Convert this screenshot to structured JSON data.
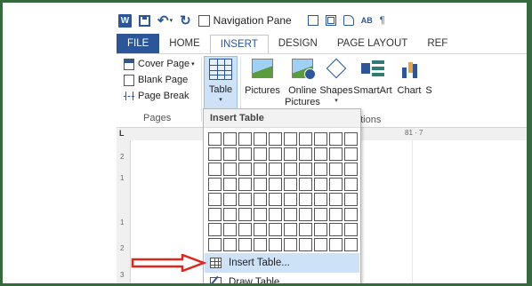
{
  "qat": {
    "word_icon": "W",
    "navigation_pane": "Navigation Pane",
    "ab_label": "AB"
  },
  "tabs": [
    {
      "label": "FILE"
    },
    {
      "label": "HOME"
    },
    {
      "label": "INSERT",
      "active": true
    },
    {
      "label": "DESIGN"
    },
    {
      "label": "PAGE LAYOUT"
    },
    {
      "label": "REF"
    }
  ],
  "pages_group": {
    "items": [
      {
        "label": "Cover Page",
        "has_dropdown": true
      },
      {
        "label": "Blank Page"
      },
      {
        "label": "Page Break"
      }
    ],
    "label": "Pages"
  },
  "ribbon": {
    "table": "Table",
    "pictures": "Pictures",
    "online_1": "Online",
    "online_2": "Pictures",
    "shapes": "Shapes",
    "smartart": "SmartArt",
    "chart": "Chart",
    "s_partial": "S",
    "illustrations_partial": "ations"
  },
  "ruler": {
    "corner": "L",
    "right_mark": "81 · 7",
    "vertical_marks": [
      "2",
      "1",
      "1",
      "2",
      "3"
    ]
  },
  "dropdown": {
    "header": "Insert Table",
    "grid": {
      "columns": 10,
      "rows": 8
    },
    "items": [
      {
        "label": "Insert Table...",
        "highlighted": true
      },
      {
        "label": "Draw Table"
      }
    ]
  },
  "colors": {
    "word_blue": "#2b579a",
    "frame_green": "#356a3c",
    "highlight": "#cde1f7",
    "arrow_red": "#e0261c"
  }
}
